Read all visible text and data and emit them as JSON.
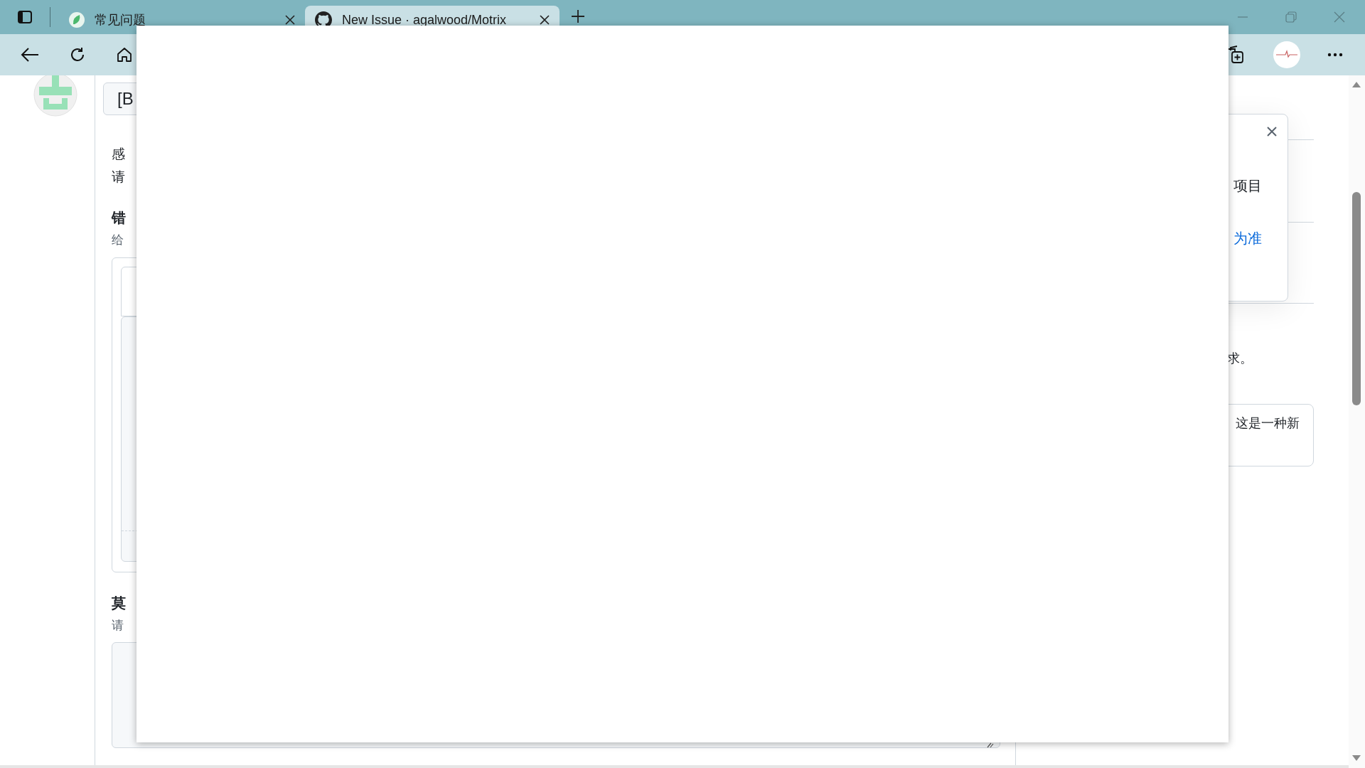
{
  "tabs": [
    {
      "title": "常见问题",
      "selected": false
    },
    {
      "title": "New Issue · agalwood/Motrix",
      "selected": true
    }
  ],
  "page": {
    "title_field": "[B",
    "left_texts": [
      {
        "text": "感",
        "kind": "body"
      },
      {
        "text": "请",
        "kind": "body"
      },
      {
        "text": "错",
        "kind": "heading"
      },
      {
        "text": "给",
        "kind": "hint"
      },
      {
        "text": "莫",
        "kind": "heading"
      },
      {
        "text": "请",
        "kind": "hint"
      }
    ],
    "popover": {
      "item": "项目",
      "link": "为准"
    },
    "side_text": "求。",
    "side_box": "这是一种新"
  }
}
